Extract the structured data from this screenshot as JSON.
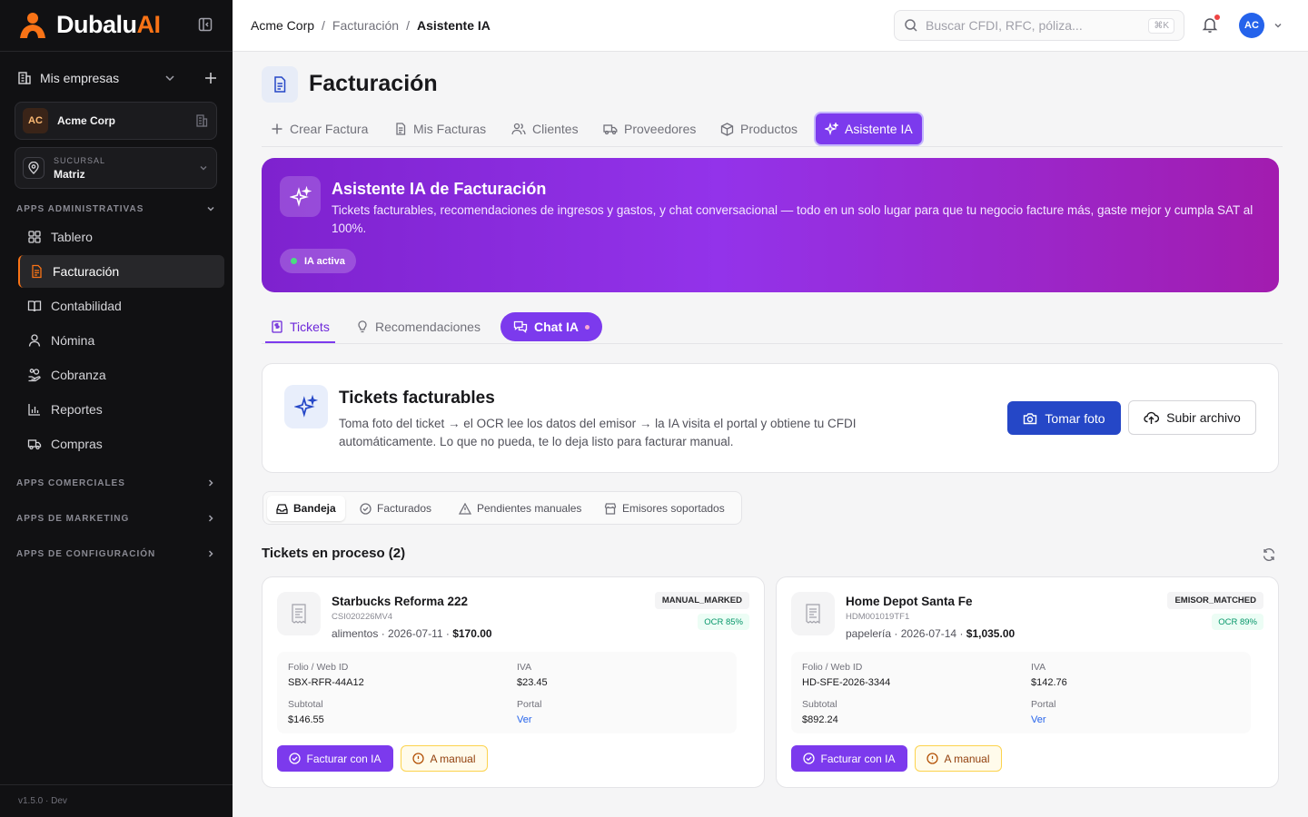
{
  "app": {
    "logo_main": "Dubalu",
    "logo_accent": "AI",
    "version": "v1.5.0 · Dev"
  },
  "sidebar": {
    "my_companies": "Mis empresas",
    "company": {
      "initials": "AC",
      "name": "Acme Corp"
    },
    "branch": {
      "label": "SUCURSAL",
      "value": "Matriz"
    },
    "sections": {
      "admin": "APPS ADMINISTRATIVAS",
      "commercial": "APPS COMERCIALES",
      "marketing": "APPS DE MARKETING",
      "config": "APPS DE CONFIGURACIÓN"
    },
    "items": [
      {
        "label": "Tablero",
        "icon": "grid-icon"
      },
      {
        "label": "Facturación",
        "icon": "document-icon",
        "active": true
      },
      {
        "label": "Contabilidad",
        "icon": "book-icon"
      },
      {
        "label": "Nómina",
        "icon": "user-icon"
      },
      {
        "label": "Cobranza",
        "icon": "hand-coins-icon"
      },
      {
        "label": "Reportes",
        "icon": "bar-chart-icon"
      },
      {
        "label": "Compras",
        "icon": "truck-icon"
      }
    ]
  },
  "header": {
    "breadcrumb": [
      "Acme Corp",
      "/",
      "Facturación",
      "/",
      "Asistente IA"
    ],
    "search_placeholder": "Buscar CFDI, RFC, póliza...",
    "search_shortcut": "⌘K",
    "user_initials": "AC"
  },
  "page": {
    "title": "Facturación",
    "tabs": [
      "Crear Factura",
      "Mis Facturas",
      "Clientes",
      "Proveedores",
      "Productos",
      "Asistente IA"
    ],
    "active_tab": "Asistente IA"
  },
  "hero": {
    "title": "Asistente IA de Facturación",
    "description": "Tickets facturables, recomendaciones de ingresos y gastos, y chat conversacional — todo en un solo lugar para que tu negocio facture más, gaste mejor y cumpla SAT al 100%.",
    "badge": "IA activa"
  },
  "subtabs": [
    "Tickets",
    "Recomendaciones",
    "Chat IA"
  ],
  "tickets_panel": {
    "title": "Tickets facturables",
    "description": "Toma foto del ticket → el OCR lee los datos del emisor → la IA visita el portal y obtiene tu CFDI automáticamente. Lo que no pueda, te lo deja listo para facturar manual.",
    "take_photo": "Tomar foto",
    "upload": "Subir archivo"
  },
  "filters": [
    "Bandeja",
    "Facturados",
    "Pendientes manuales",
    "Emisores soportados"
  ],
  "in_process_title": "Tickets en proceso (2)",
  "labels": {
    "folio": "Folio / Web ID",
    "iva": "IVA",
    "subtotal": "Subtotal",
    "portal": "Portal",
    "btn_ia": "Facturar con IA",
    "btn_manual": "A manual"
  },
  "tickets": [
    {
      "name": "Starbucks Reforma 222",
      "code": "CSI020226MV4",
      "category": "alimentos",
      "date": "2026-07-11",
      "total": "$170.00",
      "status": "MANUAL_MARKED",
      "ocr": "OCR 85%",
      "folio": "SBX-RFR-44A12",
      "iva": "$23.45",
      "subtotal": "$146.55",
      "portal": "Ver"
    },
    {
      "name": "Home Depot Santa Fe",
      "code": "HDM001019TF1",
      "category": "papelería",
      "date": "2026-07-14",
      "total": "$1,035.00",
      "status": "EMISOR_MATCHED",
      "ocr": "OCR 89%",
      "folio": "HD-SFE-2026-3344",
      "iva": "$142.76",
      "subtotal": "$892.24",
      "portal": "Ver"
    }
  ],
  "colors": {
    "brand": "#f97316",
    "purple": "#7c3aed",
    "blue": "#2547c7"
  }
}
